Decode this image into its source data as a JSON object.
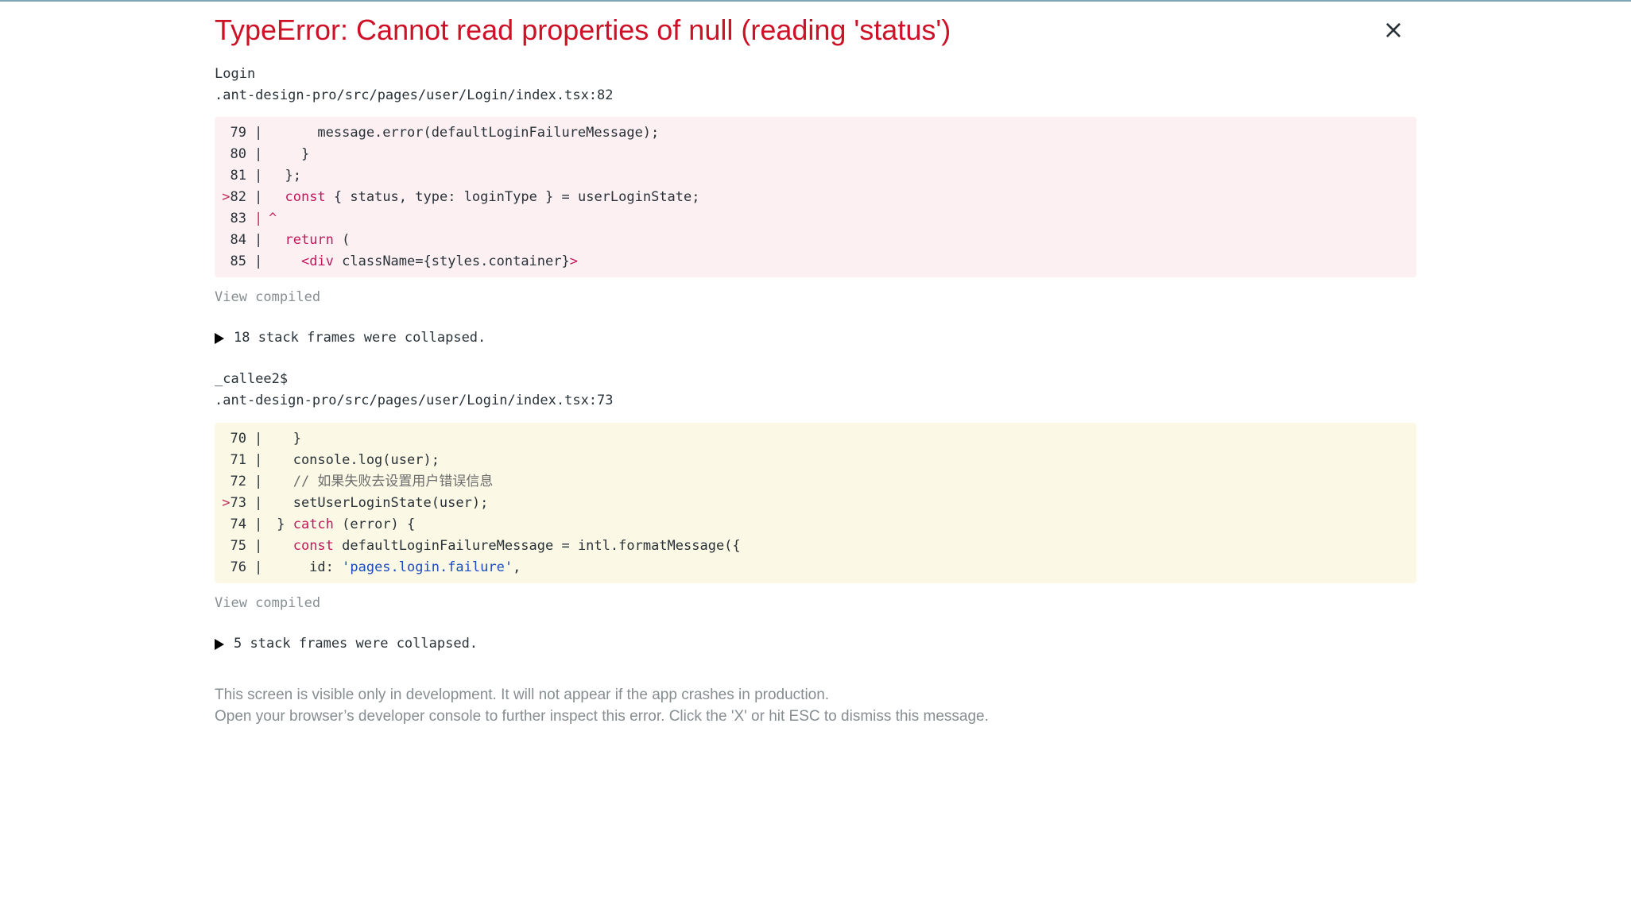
{
  "error": {
    "title": "TypeError: Cannot read properties of null (reading 'status')",
    "close_symbol": "×"
  },
  "frames": [
    {
      "name": "Login",
      "file": ".ant-design-pro/src/pages/user/Login/index.tsx:82",
      "background": "#fcf0f2",
      "lines": [
        {
          "num": "79",
          "marker": "",
          "segments": [
            {
              "t": "      message.error(defaultLoginFailureMessage);",
              "c": ""
            }
          ]
        },
        {
          "num": "80",
          "marker": "",
          "segments": [
            {
              "t": "    }",
              "c": ""
            }
          ]
        },
        {
          "num": "81",
          "marker": "",
          "segments": [
            {
              "t": "  };",
              "c": ""
            }
          ]
        },
        {
          "num": "82",
          "marker": ">",
          "segments": [
            {
              "t": "  ",
              "c": ""
            },
            {
              "t": "const",
              "c": "kw"
            },
            {
              "t": " { status, ",
              "c": ""
            },
            {
              "t": "type",
              "c": ""
            },
            {
              "t": ": loginType } = userLoginState;",
              "c": ""
            }
          ]
        },
        {
          "num": "83",
          "marker": "",
          "caret": true,
          "segments": [
            {
              "t": "^",
              "c": "caret"
            }
          ]
        },
        {
          "num": "84",
          "marker": "",
          "segments": [
            {
              "t": "  ",
              "c": ""
            },
            {
              "t": "return",
              "c": "kw"
            },
            {
              "t": " (",
              "c": ""
            }
          ]
        },
        {
          "num": "85",
          "marker": "",
          "segments": [
            {
              "t": "    ",
              "c": ""
            },
            {
              "t": "<div",
              "c": "kw"
            },
            {
              "t": " className=",
              "c": ""
            },
            {
              "t": "{styles.container}",
              "c": ""
            },
            {
              "t": ">",
              "c": "kw"
            }
          ]
        }
      ],
      "view_compiled": "View compiled",
      "collapsed_text": "18 stack frames were collapsed."
    },
    {
      "name": "_callee2$",
      "file": ".ant-design-pro/src/pages/user/Login/index.tsx:73",
      "background": "#fbf9e6",
      "lines": [
        {
          "num": "70",
          "marker": "",
          "segments": [
            {
              "t": "   }",
              "c": ""
            }
          ]
        },
        {
          "num": "71",
          "marker": "",
          "segments": [
            {
              "t": "   console.log(user);",
              "c": ""
            }
          ]
        },
        {
          "num": "72",
          "marker": "",
          "segments": [
            {
              "t": "   // 如果失败去设置用户错误信息",
              "c": "cmt"
            }
          ]
        },
        {
          "num": "73",
          "marker": ">",
          "segments": [
            {
              "t": "   setUserLoginState(user);",
              "c": ""
            }
          ]
        },
        {
          "num": "74",
          "marker": "",
          "segments": [
            {
              "t": " } ",
              "c": ""
            },
            {
              "t": "catch",
              "c": "kw"
            },
            {
              "t": " (error) {",
              "c": ""
            }
          ]
        },
        {
          "num": "75",
          "marker": "",
          "segments": [
            {
              "t": "   ",
              "c": ""
            },
            {
              "t": "const",
              "c": "kw"
            },
            {
              "t": " defaultLoginFailureMessage = intl.formatMessage({",
              "c": ""
            }
          ]
        },
        {
          "num": "76",
          "marker": "",
          "segments": [
            {
              "t": "     id: ",
              "c": ""
            },
            {
              "t": "'pages.login.failure'",
              "c": "str"
            },
            {
              "t": ",",
              "c": ""
            }
          ]
        }
      ],
      "view_compiled": "View compiled",
      "collapsed_text": "5 stack frames were collapsed."
    }
  ],
  "footer": {
    "line1": "This screen is visible only in development. It will not appear if the app crashes in production.",
    "line2": "Open your browser’s developer console to further inspect this error.  Click the 'X' or hit ESC to dismiss this message."
  }
}
